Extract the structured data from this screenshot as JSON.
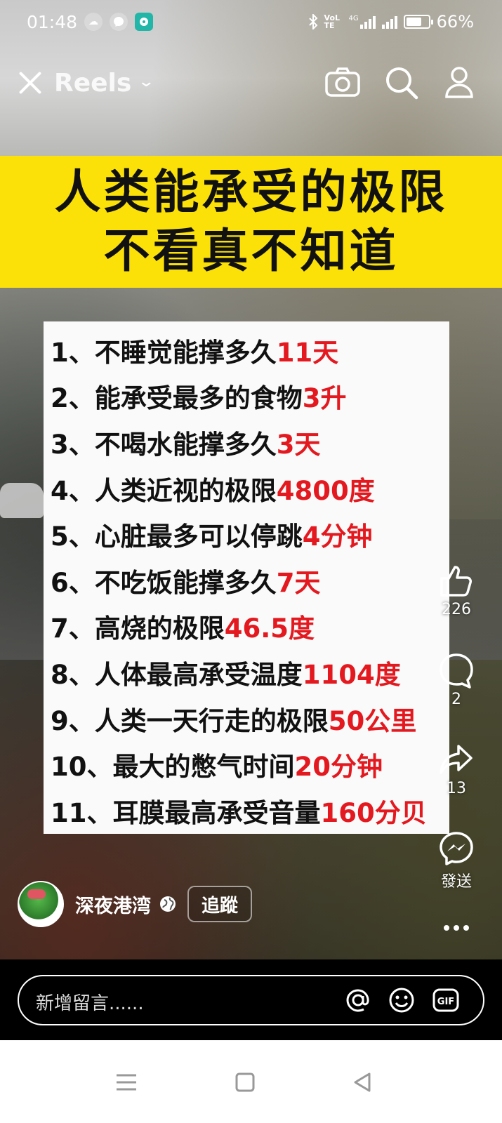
{
  "status_bar": {
    "time": "01:48",
    "network_label": "VoLTE",
    "network_type": "4G",
    "battery": "66%",
    "battery_level": 0.66
  },
  "header": {
    "title": "Reels",
    "icons": [
      "close-icon",
      "chevron-down-icon",
      "camera-icon",
      "search-icon",
      "profile-icon"
    ]
  },
  "banner": {
    "line1": "人类能承受的极限",
    "line2": "不看真不知道",
    "background_color": "#fbe108"
  },
  "list": [
    {
      "prefix": "1、",
      "text": "不睡觉能撑多久",
      "value": "11天"
    },
    {
      "prefix": "2、",
      "text": "能承受最多的食物",
      "value": "3升"
    },
    {
      "prefix": "3、",
      "text": "不喝水能撑多久",
      "value": "3天"
    },
    {
      "prefix": "4、",
      "text": "人类近视的极限",
      "value": "4800度"
    },
    {
      "prefix": "5、",
      "text": "心脏最多可以停跳",
      "value": "4分钟"
    },
    {
      "prefix": "6、",
      "text": "不吃饭能撑多久",
      "value": "7天"
    },
    {
      "prefix": "7、",
      "text": "高烧的极限",
      "value": "46.5度"
    },
    {
      "prefix": "8、",
      "text": "人体最高承受温度",
      "value": "1104度"
    },
    {
      "prefix": "9、",
      "text": "人类一天行走的极限",
      "value": "50公里"
    },
    {
      "prefix": "10、",
      "text": "最大的憋气时间",
      "value": "20分钟"
    },
    {
      "prefix": "11、",
      "text": "耳膜最高承受音量",
      "value": "160分贝"
    }
  ],
  "actions": {
    "likes": "226",
    "comments": "2",
    "shares": "13",
    "send_label": "發送"
  },
  "author": {
    "name": "深夜港湾",
    "follow_label": "追蹤"
  },
  "comment_bar": {
    "placeholder": "新增留言......",
    "icons": [
      "at-icon",
      "emoji-icon",
      "gif-icon"
    ]
  },
  "navbar": {
    "icons": [
      "menu-icon",
      "home-square-icon",
      "back-triangle-icon"
    ]
  },
  "colors": {
    "accent_red": "#e3191f",
    "banner_yellow": "#fbe108"
  }
}
